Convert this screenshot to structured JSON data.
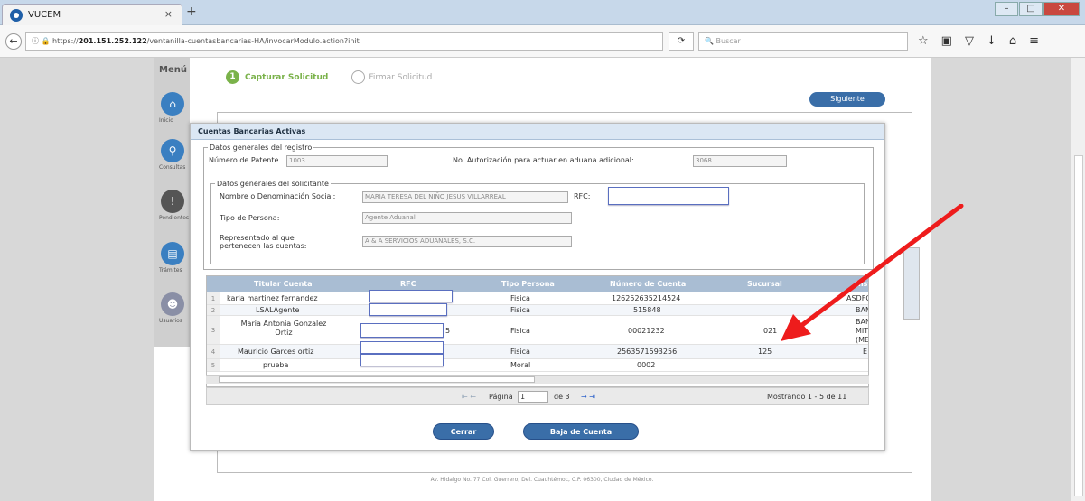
{
  "browser": {
    "tab_title": "VUCEM",
    "tab_close": "×",
    "new_tab": "+",
    "url_prefix": "https://",
    "url_host": "201.151.252.122",
    "url_path": "/ventanilla-cuentasbancarias-HA/invocarModulo.action?init",
    "search_placeholder": "Buscar"
  },
  "menu": {
    "title": "Menú",
    "items": [
      {
        "label": "Inicio",
        "icon": "home-icon"
      },
      {
        "label": "Consultas",
        "icon": "search-icon"
      },
      {
        "label": "Pendientes",
        "icon": "alert-icon"
      },
      {
        "label": "Trámites",
        "icon": "form-icon"
      },
      {
        "label": "Usuarios",
        "icon": "users-icon"
      }
    ]
  },
  "steps": {
    "step1_num": "1",
    "step1": "Capturar Solicitud",
    "step2": "Firmar Solicitud"
  },
  "siguiente": "Siguiente",
  "footer": "Av. Hidalgo No. 77 Col. Guerrero, Del. Cuauhtémoc, C.P. 06300, Ciudad de México.",
  "modal": {
    "title": "Cuentas Bancarias Activas",
    "registro": {
      "legend": "Datos generales del registro",
      "patente_label": "Número de Patente",
      "patente_value": "1003",
      "autorizacion_label": "No. Autorización para actuar en aduana adicional:",
      "autorizacion_value": "3068"
    },
    "solicitante": {
      "legend": "Datos generales del solicitante",
      "nombre_label": "Nombre o Denominación Social:",
      "nombre_value": "MARIA TERESA DEL NIÑO JESUS VILLARREAL",
      "rfc_label": "RFC:",
      "tipo_label": "Tipo de Persona:",
      "tipo_value": "Agente Aduanal",
      "repr_label1": "Representado al que",
      "repr_label2": "pertenecen las cuentas:",
      "repr_value": "A & A SERVICIOS ADUANALES, S.C."
    },
    "table": {
      "headers": [
        "Titular Cuenta",
        "RFC",
        "Tipo Persona",
        "Número de Cuenta",
        "Sucursal",
        "Instit"
      ],
      "rows": [
        {
          "n": "1",
          "titular": "karla martinez fernandez",
          "tipo": "Fisica",
          "cuenta": "126252635214524",
          "sucursal": "",
          "inst": "ASDFG ."
        },
        {
          "n": "2",
          "titular": "LSALAgente",
          "tipo": "Fisica",
          "cuenta": "515848",
          "sucursal": "",
          "inst": "BAN"
        },
        {
          "n": "3",
          "titular": "Maria Antonia Gonzalez Ortiz",
          "rfc_tail": "5",
          "tipo": "Fisica",
          "cuenta": "00021232",
          "sucursal": "021",
          "inst": "BAN MIT (ME"
        },
        {
          "n": "4",
          "titular": "Mauricio Garces ortiz",
          "tipo": "Fisica",
          "cuenta": "2563571593256",
          "sucursal": "125",
          "inst": "E"
        },
        {
          "n": "5",
          "titular": "prueba",
          "tipo": "Moral",
          "cuenta": "0002",
          "sucursal": "",
          "inst": ""
        }
      ]
    },
    "pager": {
      "pagina_label": "Página",
      "page": "1",
      "de": "de 3",
      "mostrando": "Mostrando 1 - 5 de 11"
    },
    "cerrar": "Cerrar",
    "baja": "Baja de Cuenta"
  },
  "colors": {
    "accent": "#3a6ea8",
    "step_green": "#7ab24a",
    "arrow": "#ee1c1c"
  }
}
